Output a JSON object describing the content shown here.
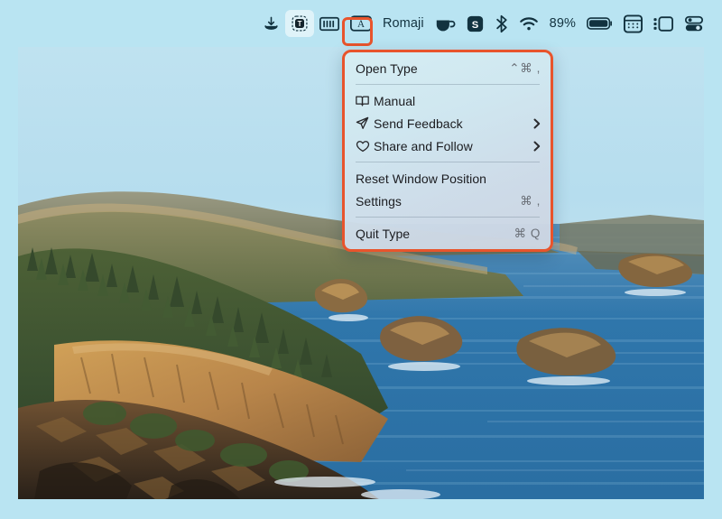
{
  "desktop": {
    "wallpaper_name": "oregon-coast-photo",
    "wallpaper_alt": "Coastal cliffs with evergreen forest and blue ocean",
    "border_color": "#b9e4f2"
  },
  "menubar": {
    "items": [
      {
        "name": "download-icon",
        "icon": "download",
        "label": ""
      },
      {
        "name": "type-app-status-icon",
        "icon": "type-app",
        "label": ""
      },
      {
        "name": "keyboard-icon",
        "icon": "keyboard",
        "label": ""
      },
      {
        "name": "input-source-a-icon",
        "icon": "letter-a-box",
        "label": ""
      },
      {
        "name": "input-source-label",
        "icon": "text",
        "label": "Romaji"
      },
      {
        "name": "coffee-icon",
        "icon": "coffee-cup",
        "label": ""
      },
      {
        "name": "s-app-icon",
        "icon": "letter-s-badge",
        "label": ""
      },
      {
        "name": "bluetooth-icon",
        "icon": "bluetooth",
        "label": ""
      },
      {
        "name": "wifi-icon",
        "icon": "wifi",
        "label": ""
      },
      {
        "name": "battery-percentage",
        "icon": "text",
        "label": "89%"
      },
      {
        "name": "battery-icon",
        "icon": "battery",
        "label": ""
      },
      {
        "name": "calendar-icon",
        "icon": "calendar-grid",
        "label": ""
      },
      {
        "name": "stage-manager-icon",
        "icon": "stage-manager",
        "label": ""
      },
      {
        "name": "control-center-icon",
        "icon": "control-center",
        "label": ""
      }
    ],
    "active_item_name": "type-app-status-icon",
    "highlight_color": "#e8542c"
  },
  "type_menu": {
    "accent_border": "#e8542c",
    "groups": [
      {
        "rows": [
          {
            "label": "Open Type",
            "icon": null,
            "shortcut": "⌃⌘ ,",
            "submenu": false
          }
        ]
      },
      {
        "rows": [
          {
            "label": "Manual",
            "icon": "book",
            "shortcut": "",
            "submenu": false
          },
          {
            "label": "Send Feedback",
            "icon": "paper-plane",
            "shortcut": "",
            "submenu": true
          },
          {
            "label": "Share and Follow",
            "icon": "heart",
            "shortcut": "",
            "submenu": true
          }
        ]
      },
      {
        "rows": [
          {
            "label": "Reset Window Position",
            "icon": null,
            "shortcut": "",
            "submenu": false
          },
          {
            "label": "Settings",
            "icon": null,
            "shortcut": "⌘ ,",
            "submenu": false
          }
        ]
      },
      {
        "rows": [
          {
            "label": "Quit Type",
            "icon": null,
            "shortcut": "⌘ Q",
            "submenu": false
          }
        ]
      }
    ]
  }
}
